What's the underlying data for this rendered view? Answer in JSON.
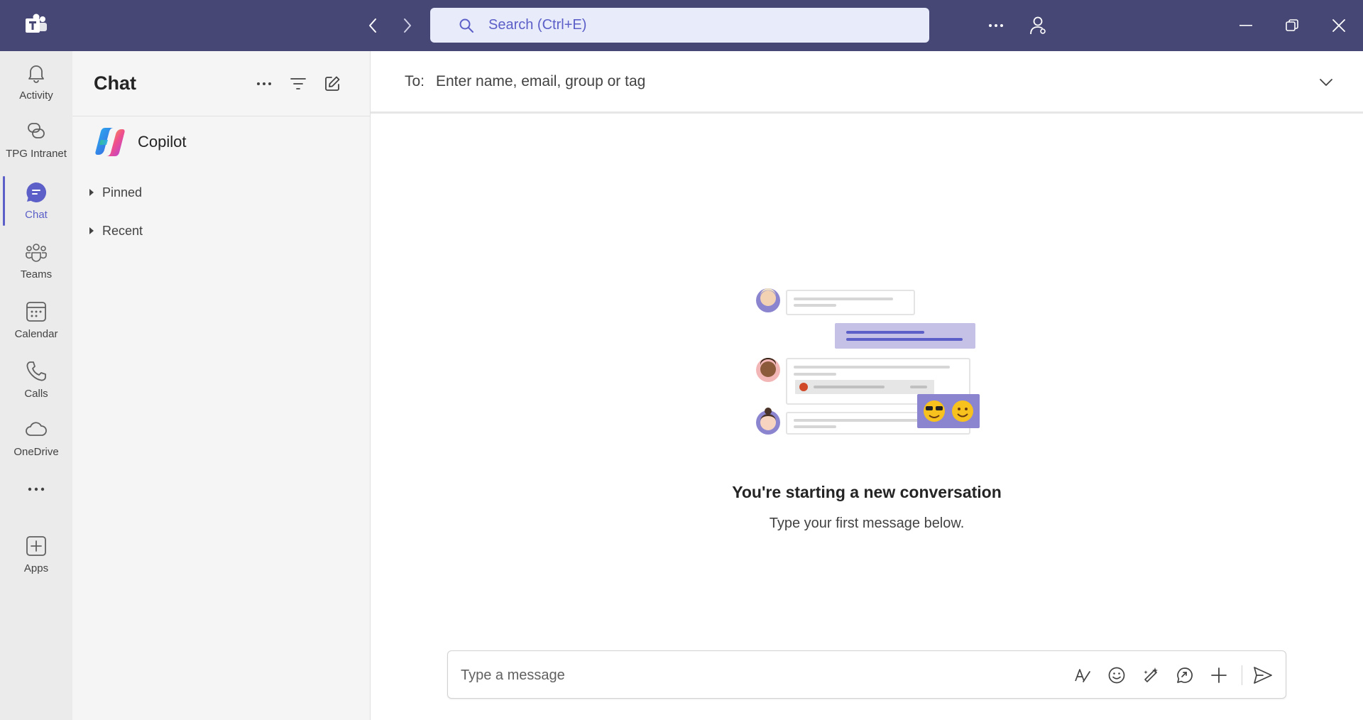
{
  "titlebar": {
    "search_placeholder": "Search (Ctrl+E)",
    "accent_color": "#464775"
  },
  "rail": {
    "items": [
      {
        "label": "Activity",
        "icon": "bell-icon"
      },
      {
        "label": "TPG Intranet",
        "icon": "link-icon"
      },
      {
        "label": "Chat",
        "icon": "chat-icon",
        "active": true
      },
      {
        "label": "Teams",
        "icon": "teams-icon"
      },
      {
        "label": "Calendar",
        "icon": "calendar-icon"
      },
      {
        "label": "Calls",
        "icon": "phone-icon"
      },
      {
        "label": "OneDrive",
        "icon": "cloud-icon"
      },
      {
        "label": "",
        "icon": "more-icon"
      },
      {
        "label": "Apps",
        "icon": "add-apps-icon"
      }
    ]
  },
  "chatlist": {
    "title": "Chat",
    "copilot_label": "Copilot",
    "sections": [
      "Pinned",
      "Recent"
    ]
  },
  "main": {
    "to_label": "To:",
    "to_placeholder": "Enter name, email, group or tag",
    "empty_title": "You're starting a new conversation",
    "empty_subtitle": "Type your first message below.",
    "composer_placeholder": "Type a message"
  },
  "colors": {
    "brand": "#5b5fc7",
    "titlebar": "#464775",
    "illustration_bubble": "#c5c1e6",
    "illustration_emoji_bubble": "#8b85d0"
  }
}
